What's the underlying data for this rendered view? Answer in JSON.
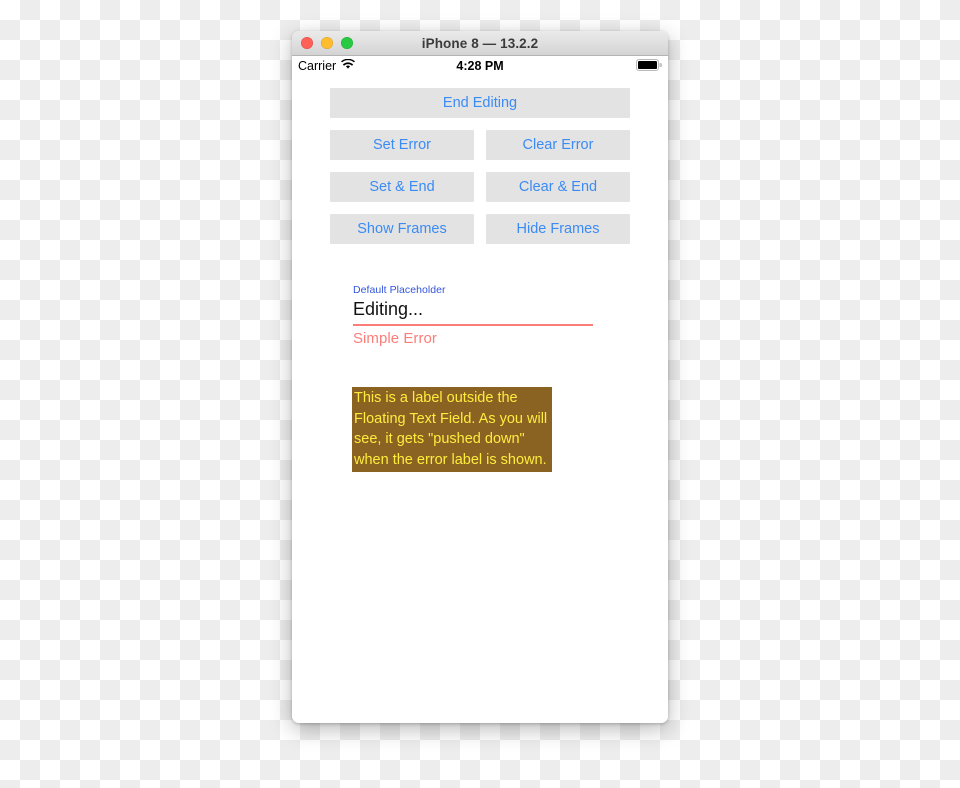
{
  "window": {
    "title": "iPhone 8 — 13.2.2",
    "traffic_lights": [
      {
        "name": "close",
        "color": "#ff5f57"
      },
      {
        "name": "minimize",
        "color": "#ffbd2e"
      },
      {
        "name": "zoom",
        "color": "#28ca42"
      }
    ]
  },
  "status_bar": {
    "carrier": "Carrier",
    "wifi_icon": "wifi-icon",
    "time": "4:28 PM",
    "battery_icon": "battery-full-icon"
  },
  "buttons": {
    "end_editing": "End Editing",
    "set_error": "Set Error",
    "clear_error": "Clear Error",
    "set_and_end": "Set & End",
    "clear_and_end": "Clear & End",
    "show_frames": "Show Frames",
    "hide_frames": "Hide Frames",
    "tint_color": "#3b8bf5",
    "background_color": "#e3e3e3"
  },
  "text_field": {
    "placeholder": "Default Placeholder",
    "value": "Editing...",
    "error": "Simple Error",
    "placeholder_color": "#3355dd",
    "error_color": "#fb7e79",
    "underline_color": "#fb7e79"
  },
  "outside_label": {
    "text": "This is a label outside the Floating Text Field. As you will see, it gets \"pushed down\" when the error label is shown.",
    "background_color": "#8a6323",
    "text_color": "#ffec3d"
  }
}
